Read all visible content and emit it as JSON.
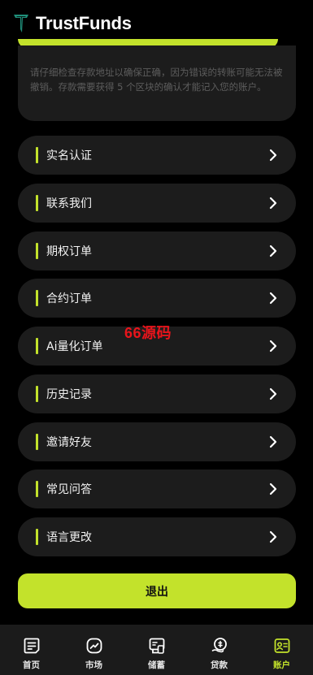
{
  "header": {
    "brand": "TrustFunds"
  },
  "notice": {
    "text": "请仔细检查存款地址以确保正确，因为错误的转账可能无法被撤销。存款需要获得 5 个区块的确认才能记入您的账户。"
  },
  "menu": [
    {
      "label": "实名认证"
    },
    {
      "label": "联系我们"
    },
    {
      "label": "期权订单"
    },
    {
      "label": "合约订单"
    },
    {
      "label": "Ai量化订单"
    },
    {
      "label": "历史记录"
    },
    {
      "label": "邀请好友"
    },
    {
      "label": "常见问答"
    },
    {
      "label": "语言更改"
    }
  ],
  "watermark": "66源码",
  "logout_label": "退出",
  "tabs": [
    {
      "label": "首页",
      "icon": "home-icon"
    },
    {
      "label": "市场",
      "icon": "market-icon"
    },
    {
      "label": "储蓄",
      "icon": "savings-icon"
    },
    {
      "label": "贷款",
      "icon": "loan-icon"
    },
    {
      "label": "账户",
      "icon": "account-icon",
      "active": true
    }
  ],
  "colors": {
    "accent": "#c3e22b",
    "card": "#1c1c1c",
    "background": "#000000",
    "watermark": "#e8141b"
  }
}
